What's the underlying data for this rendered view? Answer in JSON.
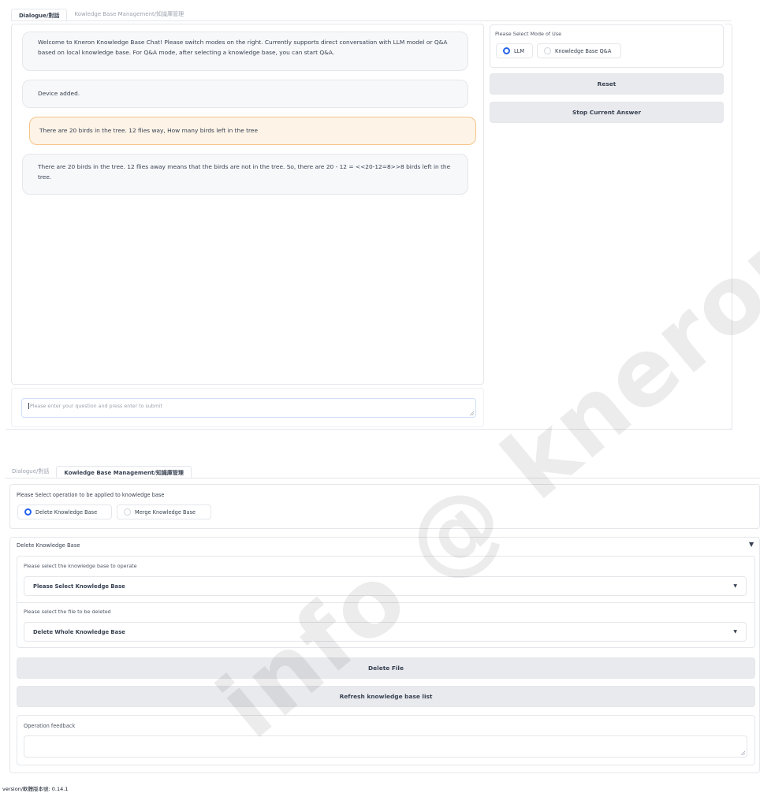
{
  "top_tabs": {
    "tab1": "Dialogue/對話",
    "tab2": "Kowledge Base Management/知識庫管理"
  },
  "chat": {
    "messages": [
      "Welcome to Kneron Knowledge Base Chat! Please switch modes on the right. Currently supports direct conversation with LLM model or Q&A based on local knowledge base. For Q&A mode, after selecting a knowledge base, you can start Q&A.",
      "Device added.",
      "There are 20 birds in the tree. 12 flies way, How many birds left in the tree",
      "There are 20 birds in the tree. 12 flies away means that the birds are not in the tree. So, there are 20 - 12 = <<20-12=8>>8 birds left in the tree."
    ],
    "input_placeholder": "Please enter your question and press enter to submit"
  },
  "mode": {
    "label": "Please Select Mode of Use",
    "options": [
      "LLM",
      "Knowledge Base Q&A"
    ],
    "selected": "LLM"
  },
  "buttons": {
    "reset": "Reset",
    "stop": "Stop Current Answer"
  },
  "bottom_tabs": {
    "tab1": "Dialogue/對話",
    "tab2": "Kowledge Base Management/知識庫管理"
  },
  "kb": {
    "operation_label": "Please Select operation to be applied to knowledge base",
    "operation_options": [
      "Delete Knowledge Base",
      "Merge Knowledge Base"
    ],
    "operation_selected": "Delete Knowledge Base",
    "accordion_title": "Delete Knowledge Base",
    "select_kb_label": "Please select the knowledge base to operate",
    "select_kb_value": "Please Select Knowledge Base",
    "select_file_label": "Please select the file to be deleted",
    "select_file_value": "Delete Whole Knowledge Base",
    "delete_file_button": "Delete File",
    "refresh_button": "Refresh knowledge base list",
    "feedback_label": "Operation feedback"
  },
  "footer": {
    "version": "version/軟體版本號: 0.14.1"
  },
  "watermark": "info @ kneron.us"
}
